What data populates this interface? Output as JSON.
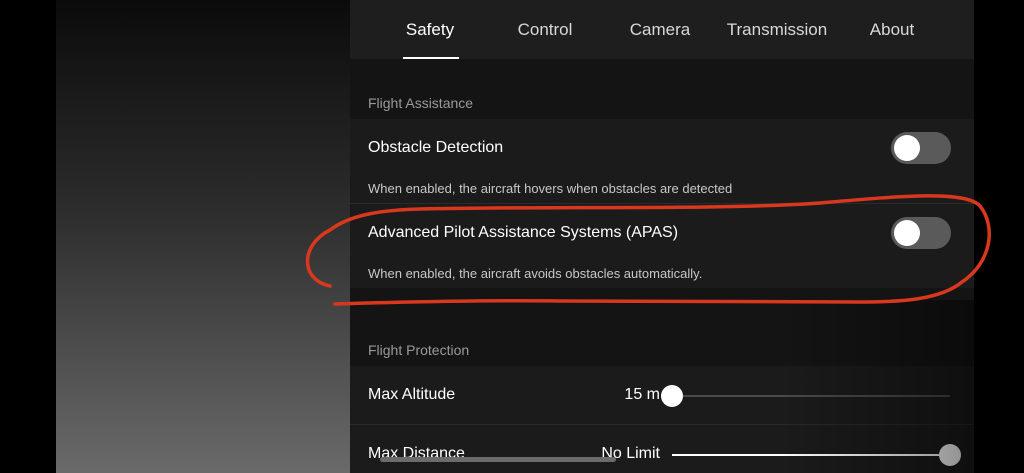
{
  "tabs": [
    {
      "label": "Safety",
      "active": true
    },
    {
      "label": "Control"
    },
    {
      "label": "Camera"
    },
    {
      "label": "Transmission"
    },
    {
      "label": "About"
    }
  ],
  "flight_assistance": {
    "section_title": "Flight Assistance",
    "obstacle_detection": {
      "title": "Obstacle Detection",
      "description": "When enabled, the aircraft hovers when obstacles are detected",
      "enabled": false
    },
    "apas": {
      "title": "Advanced Pilot Assistance Systems (APAS)",
      "description": "When enabled, the aircraft avoids obstacles automatically.",
      "enabled": false
    }
  },
  "flight_protection": {
    "section_title": "Flight Protection",
    "max_altitude": {
      "label": "Max Altitude",
      "value": "15 m",
      "level": 0.0
    },
    "max_distance": {
      "label": "Max Distance",
      "value": "No Limit",
      "level": 1.0
    }
  },
  "colors": {
    "panel_bg": "#141414",
    "tab_bar_bg": "#1e1e1e",
    "annotation_red": "#d9381e",
    "track_inactive": "#4a4a4a",
    "track_active": "#ffffff"
  }
}
